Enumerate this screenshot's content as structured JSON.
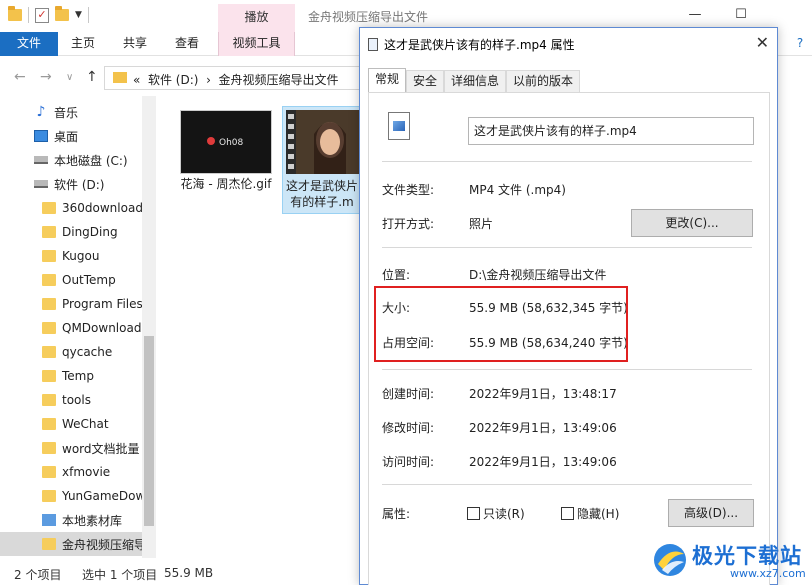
{
  "explorer": {
    "title": "金舟视频压缩导出文件",
    "context_tab": "播放",
    "ribbon_tabs": [
      "文件",
      "主页",
      "共享",
      "查看",
      "视频工具"
    ],
    "address": [
      "«",
      "软件 (D:)",
      "›",
      "金舟视频压缩导出文件"
    ],
    "nav_items": [
      {
        "label": "音乐",
        "icon": "music-icon"
      },
      {
        "label": "桌面",
        "icon": "desktop-icon"
      },
      {
        "label": "本地磁盘 (C:)",
        "icon": "drive-icon"
      },
      {
        "label": "软件 (D:)",
        "icon": "drive-icon"
      },
      {
        "label": "360download",
        "icon": "folder-icon"
      },
      {
        "label": "DingDing",
        "icon": "folder-icon"
      },
      {
        "label": "Kugou",
        "icon": "folder-icon"
      },
      {
        "label": "OutTemp",
        "icon": "folder-icon"
      },
      {
        "label": "Program Files",
        "icon": "folder-icon"
      },
      {
        "label": "QMDownload",
        "icon": "folder-icon"
      },
      {
        "label": "qycache",
        "icon": "folder-icon"
      },
      {
        "label": "Temp",
        "icon": "folder-icon"
      },
      {
        "label": "tools",
        "icon": "folder-icon"
      },
      {
        "label": "WeChat",
        "icon": "folder-icon"
      },
      {
        "label": "word文档批量",
        "icon": "folder-icon"
      },
      {
        "label": "xfmovie",
        "icon": "folder-icon"
      },
      {
        "label": "YunGameDow",
        "icon": "folder-icon"
      },
      {
        "label": "本地素材库",
        "icon": "library-icon"
      },
      {
        "label": "金舟视频压缩导",
        "icon": "folder-icon"
      }
    ],
    "files": [
      {
        "name_line1": "花海 - 周杰伦.gif",
        "name_line2": "",
        "thumb_text": "Oh08"
      },
      {
        "name_line1": "这才是武侠片",
        "name_line2": "有的样子.m",
        "thumb_text": ""
      }
    ],
    "status": {
      "count": "2 个项目",
      "selected": "选中 1 个项目",
      "size": "55.9 MB"
    }
  },
  "dialog": {
    "title": "这才是武侠片该有的样子.mp4 属性",
    "tabs": [
      "常规",
      "安全",
      "详细信息",
      "以前的版本"
    ],
    "file_name": "这才是武侠片该有的样子.mp4",
    "rows": {
      "type_label": "文件类型:",
      "type_value": "MP4 文件 (.mp4)",
      "open_label": "打开方式:",
      "open_value": "照片",
      "change_button": "更改(C)...",
      "location_label": "位置:",
      "location_value": "D:\\金舟视频压缩导出文件",
      "size_label": "大小:",
      "size_value": "55.9 MB (58,632,345 字节)",
      "disk_label": "占用空间:",
      "disk_value": "55.9 MB (58,634,240 字节)",
      "created_label": "创建时间:",
      "created_value": "2022年9月1日，13:48:17",
      "modified_label": "修改时间:",
      "modified_value": "2022年9月1日，13:49:06",
      "accessed_label": "访问时间:",
      "accessed_value": "2022年9月1日，13:49:06",
      "attr_label": "属性:",
      "readonly_label": "只读(R)",
      "hidden_label": "隐藏(H)",
      "advanced_button": "高级(D)..."
    }
  },
  "watermark": {
    "text": "极光下载站",
    "url": "www.xz7.com"
  },
  "colors": {
    "accent": "#1b6ec2",
    "context_tab": "#fbe3ec",
    "highlight": "#e02020",
    "selection": "#cce6f7"
  }
}
